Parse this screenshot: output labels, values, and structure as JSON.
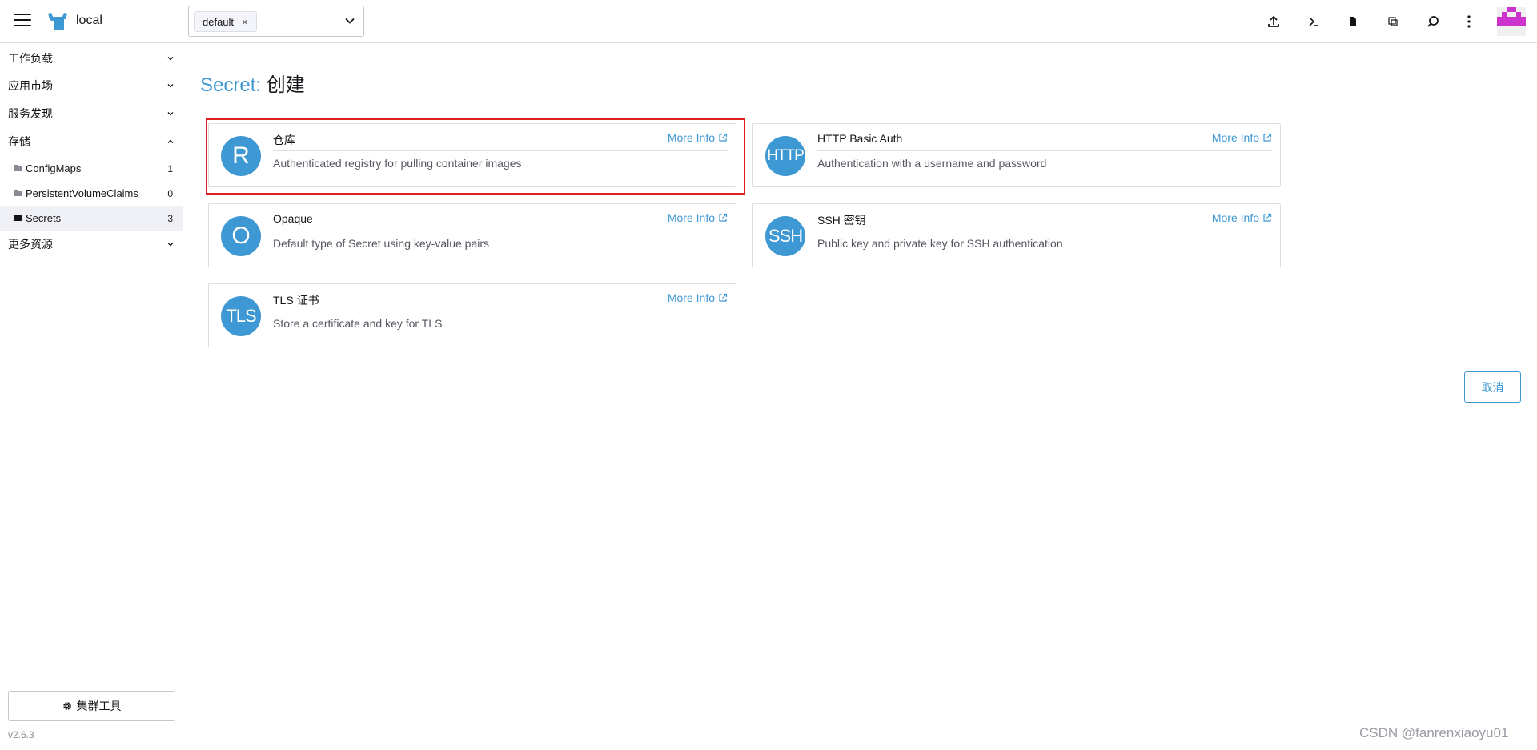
{
  "header": {
    "cluster_name": "local",
    "namespace_chip": "default",
    "namespace_chip_remove": "×",
    "icons": [
      "upload-icon",
      "terminal-icon",
      "file-icon",
      "copy-icon",
      "search-icon",
      "more-vert-icon"
    ]
  },
  "sidebar": {
    "groups": {
      "workload": "工作负载",
      "apps": "应用市场",
      "service_discovery": "服务发现",
      "storage": "存储",
      "more_resources": "更多资源"
    },
    "storage_items": [
      {
        "label": "ConfigMaps",
        "count": "1"
      },
      {
        "label": "PersistentVolumeClaims",
        "count": "0"
      },
      {
        "label": "Secrets",
        "count": "3"
      }
    ],
    "cluster_tools": "集群工具",
    "version": "v2.6.3"
  },
  "main": {
    "title_crumb": "Secret:",
    "title_action": "创建",
    "more_info": "More Info",
    "cards": [
      {
        "icon": "R",
        "title": "仓库",
        "desc": "Authenticated registry for pulling container images"
      },
      {
        "icon": "HTTP",
        "title": "HTTP Basic Auth",
        "desc": "Authentication with a username and password"
      },
      {
        "icon": "O",
        "title": "Opaque",
        "desc": "Default type of Secret using key-value pairs"
      },
      {
        "icon": "SSH",
        "title": "SSH 密钥",
        "desc": "Public key and private key for SSH authentication"
      },
      {
        "icon": "TLS",
        "title": "TLS 证书",
        "desc": "Store a certificate and key for TLS"
      }
    ],
    "cancel": "取消"
  },
  "watermark": "CSDN @fanrenxiaoyu01",
  "colors": {
    "accent": "#3d98d3",
    "highlight": "#e02020",
    "border": "#dcdee7"
  }
}
